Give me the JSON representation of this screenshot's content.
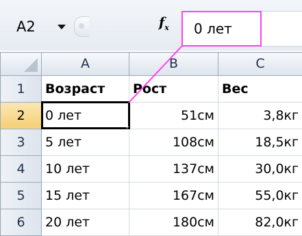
{
  "formula_bar": {
    "name_box": "A2",
    "fx_label": "f",
    "fx_sub": "x",
    "formula_value": "0 лет"
  },
  "sheet": {
    "columns": [
      "A",
      "B",
      "C"
    ],
    "rows": [
      {
        "num": "1",
        "cells": [
          "Возраст",
          "Рост",
          "Вес"
        ]
      },
      {
        "num": "2",
        "cells": [
          "0 лет",
          "51см",
          "3,8кг"
        ]
      },
      {
        "num": "3",
        "cells": [
          "5 лет",
          "108см",
          "18,5кг"
        ]
      },
      {
        "num": "4",
        "cells": [
          "10 лет",
          "137см",
          "30,0кг"
        ]
      },
      {
        "num": "5",
        "cells": [
          "15 лет",
          "167см",
          "55,0кг"
        ]
      },
      {
        "num": "6",
        "cells": [
          "20 лет",
          "180см",
          "82,0кг"
        ]
      }
    ]
  },
  "colors": {
    "highlight": "#ff3ff0",
    "active_header": "#f6cf76"
  }
}
